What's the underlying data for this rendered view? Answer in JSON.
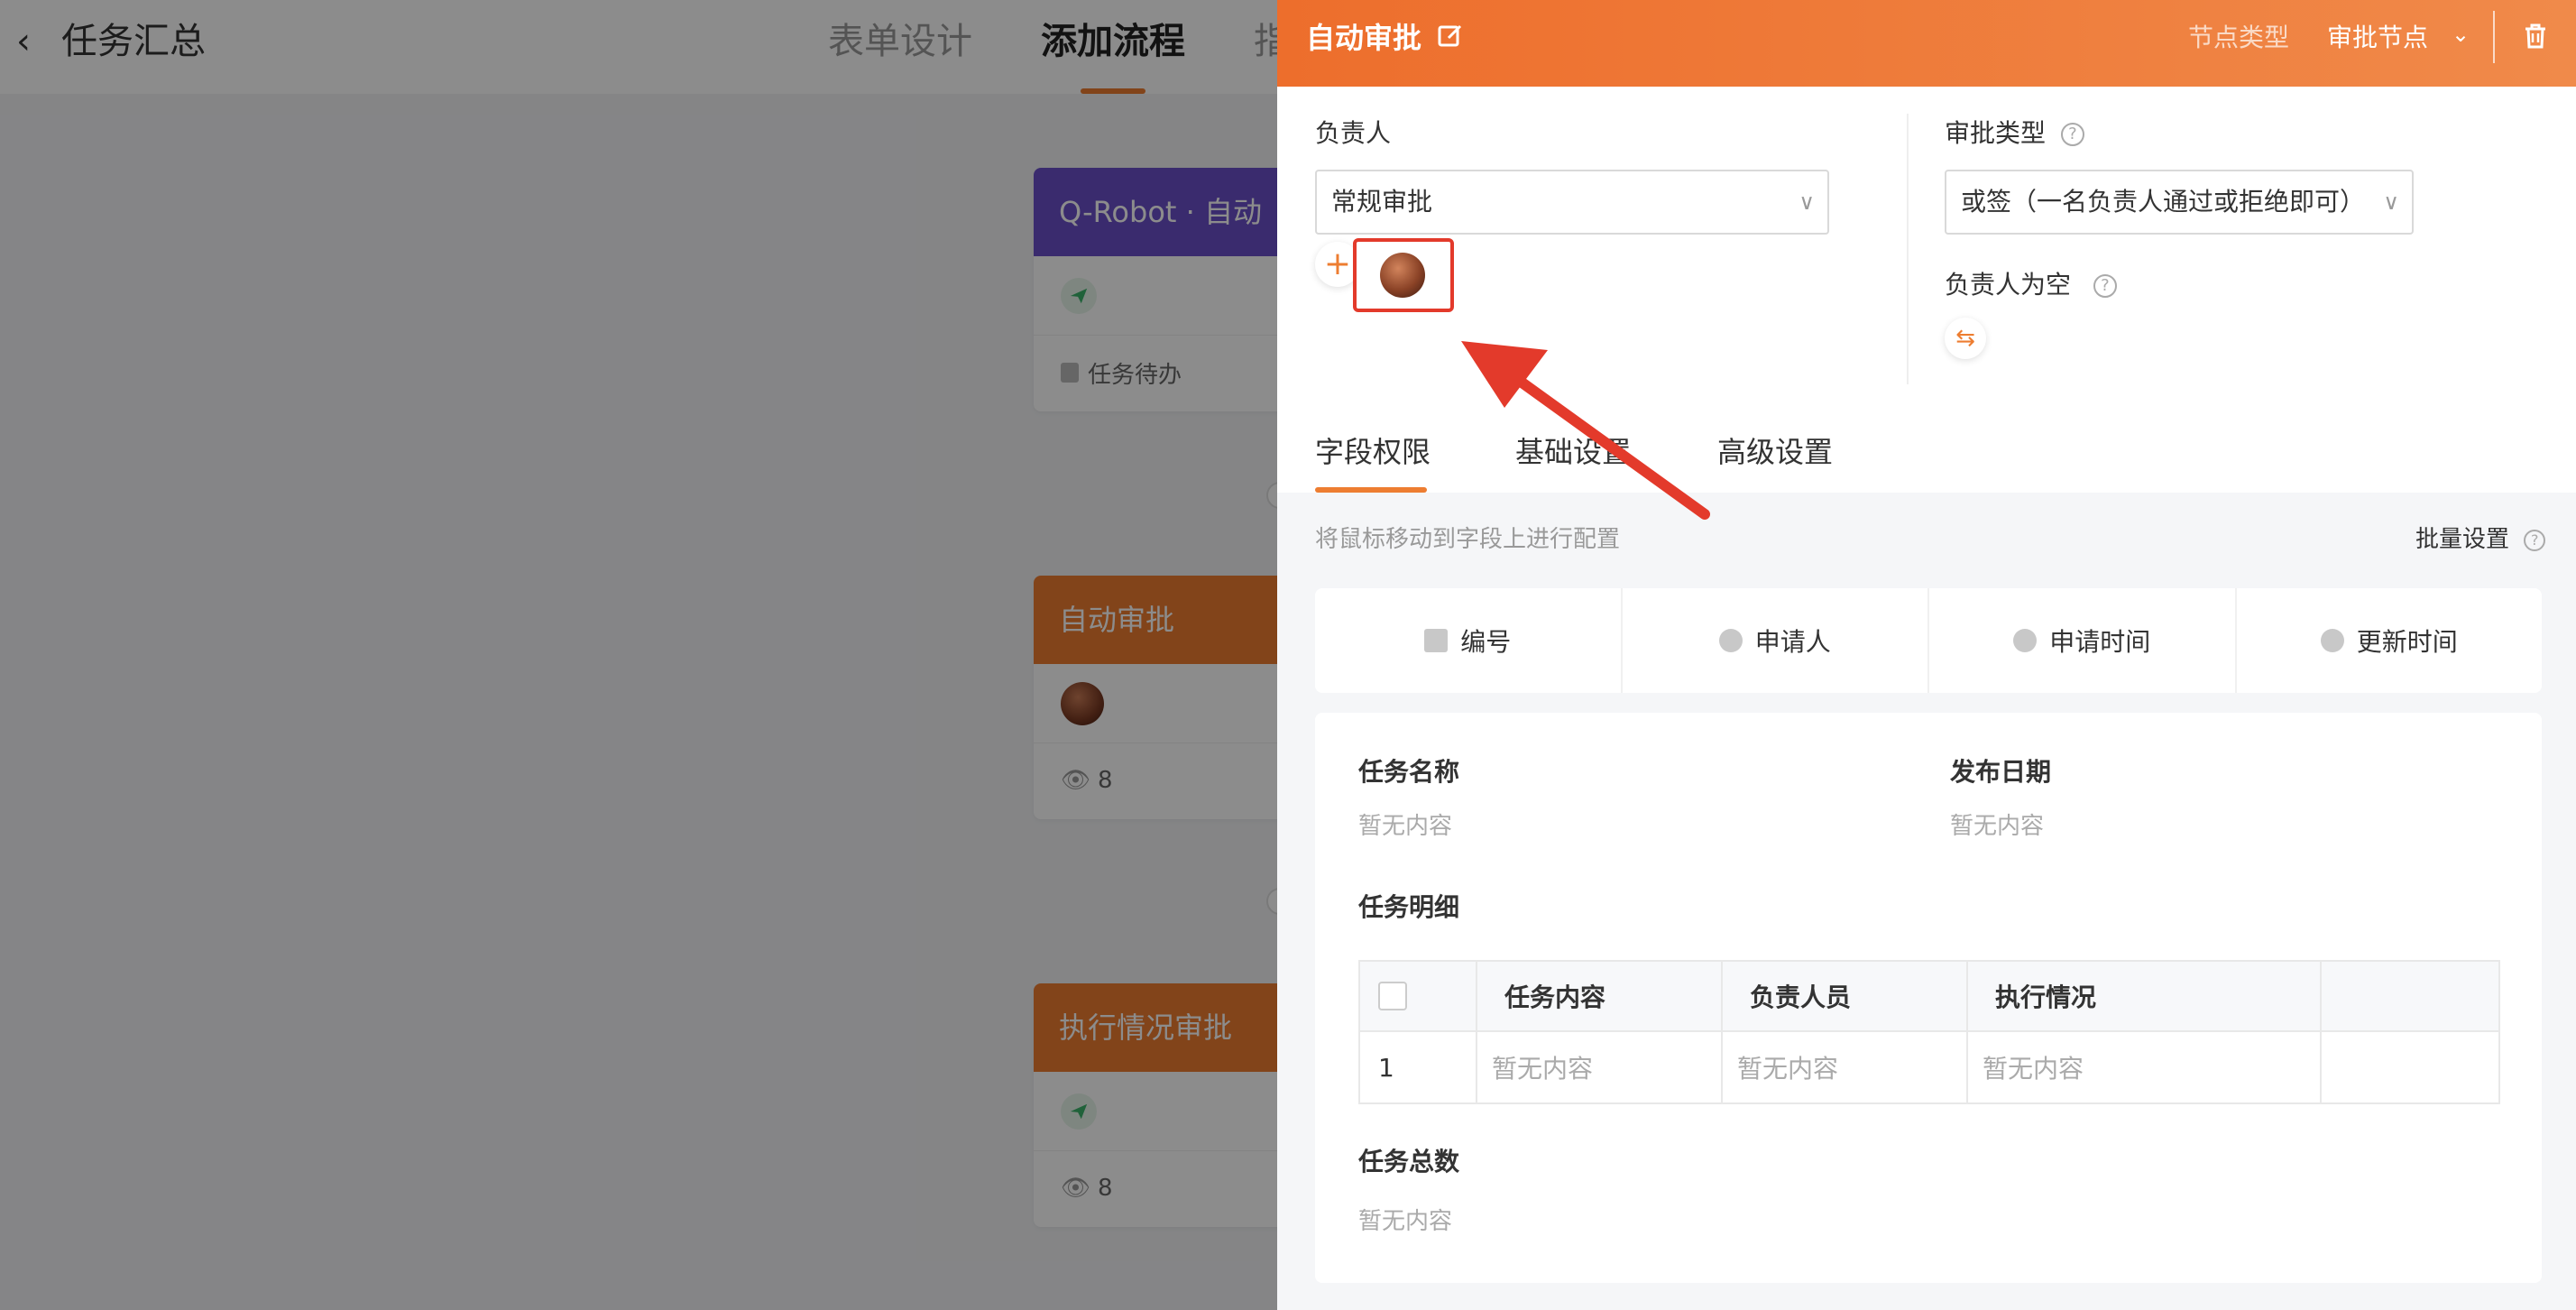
{
  "background_app": {
    "back_icon": "chevron-left-icon",
    "title": "任务汇总",
    "tabs": [
      "表单设计",
      "添加流程",
      "指"
    ],
    "active_tab_index": 1,
    "cards": [
      {
        "header": "Q-Robot · 自动",
        "header_color": "#6b4fc9",
        "row_icon": "send-icon",
        "footer": "任务待办"
      },
      {
        "header": "自动审批",
        "header_color": "#ed7d31",
        "row_icon": "avatar",
        "footer": "8"
      },
      {
        "header": "执行情况审批",
        "header_color": "#ed7d31",
        "row_icon": "send-icon",
        "footer": "8"
      }
    ]
  },
  "panel": {
    "title": "自动审批",
    "node_type_label": "节点类型",
    "node_type_value": "审批节点",
    "assignee": {
      "label": "负责人",
      "select_value": "常规审批"
    },
    "approval_type": {
      "label": "审批类型",
      "select_value": "或签（一名负责人通过或拒绝即可）"
    },
    "empty_assignee": {
      "label": "负责人为空"
    },
    "tabs": [
      "字段权限",
      "基础设置",
      "高级设置"
    ],
    "active_tab_index": 0,
    "hint": "将鼠标移动到字段上进行配置",
    "bulk_settings": "批量设置",
    "system_fields": [
      {
        "label": "编号",
        "icon": "id-icon"
      },
      {
        "label": "申请人",
        "icon": "user-icon"
      },
      {
        "label": "申请时间",
        "icon": "clock-icon"
      },
      {
        "label": "更新时间",
        "icon": "update-icon"
      }
    ],
    "form": {
      "task_name": {
        "label": "任务名称",
        "value": "暂无内容"
      },
      "publish_date": {
        "label": "发布日期",
        "value": "暂无内容"
      },
      "task_detail": {
        "label": "任务明细",
        "columns": [
          "任务内容",
          "负责人员",
          "执行情况"
        ],
        "rows": [
          {
            "index": "1",
            "cells": [
              "暂无内容",
              "暂无内容",
              "暂无内容"
            ]
          }
        ]
      },
      "task_total": {
        "label": "任务总数",
        "value": "暂无内容"
      }
    },
    "accent_color": "#ed7d31"
  }
}
